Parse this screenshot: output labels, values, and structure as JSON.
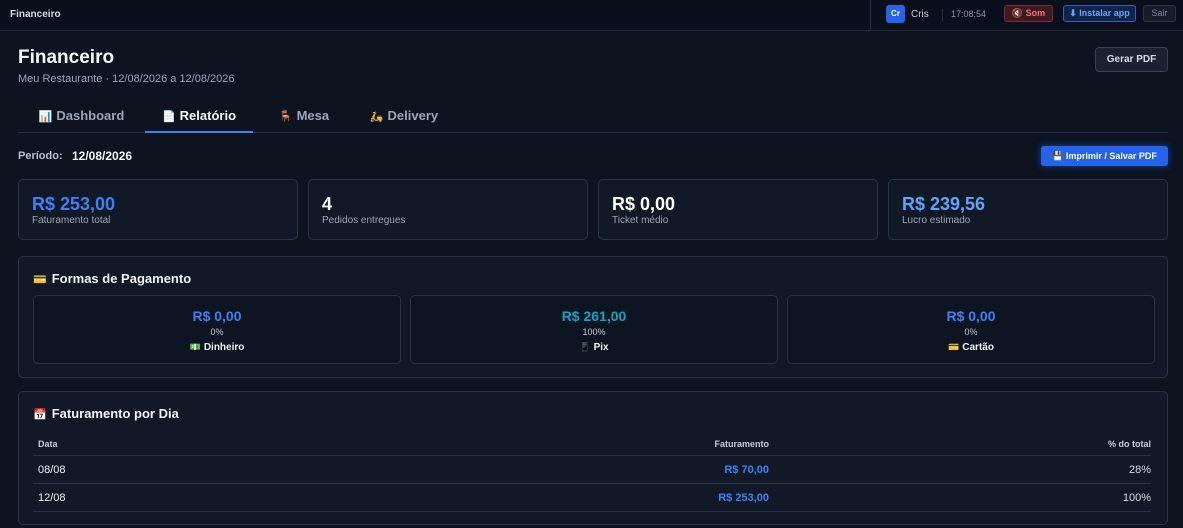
{
  "topbar": {
    "app_title": "Financeiro",
    "avatar_initials": "Cr",
    "username": "Cris",
    "clock": "17:08:54",
    "sound_label": "🔇 Som",
    "install_label": "⬇ Instalar app",
    "logout_label": "Sair"
  },
  "header": {
    "title": "Financeiro",
    "subtitle": "Meu Restaurante · 12/08/2026 a 12/08/2026",
    "pdf_button": "Gerar PDF"
  },
  "tabs": [
    {
      "icon": "📊",
      "label": "Dashboard",
      "active": false
    },
    {
      "icon": "📄",
      "label": "Relatório",
      "active": true
    },
    {
      "icon": "🪑",
      "label": "Mesa",
      "active": false
    },
    {
      "icon": "🛵",
      "label": "Delivery",
      "active": false
    }
  ],
  "period": {
    "label": "Período:",
    "value": "12/08/2026",
    "print_button": "💾 Imprimir / Salvar PDF"
  },
  "kpis": [
    {
      "value": "R$ 253,00",
      "label": "Faturamento total",
      "color": "#3b82f6"
    },
    {
      "value": "4",
      "label": "Pedidos entregues",
      "color": "#ffffff"
    },
    {
      "value": "R$ 0,00",
      "label": "Ticket médio",
      "color": "#ffffff"
    },
    {
      "value": "R$ 239,56",
      "label": "Lucro estimado",
      "color": "#60a5fa"
    }
  ],
  "payments": {
    "icon": "💳",
    "title": "Formas de Pagamento",
    "items": [
      {
        "amount": "R$ 0,00",
        "percent": "0%",
        "icon": "💵",
        "name": "Dinheiro",
        "color": "#3b82f6"
      },
      {
        "amount": "R$ 261,00",
        "percent": "100%",
        "icon": "📱",
        "name": "Pix",
        "color": "#0ea5c4"
      },
      {
        "amount": "R$ 0,00",
        "percent": "0%",
        "icon": "💳",
        "name": "Cartão",
        "color": "#3b82f6"
      }
    ]
  },
  "daily": {
    "icon": "📅",
    "title": "Faturamento por Dia",
    "columns": [
      "Data",
      "Faturamento",
      "% do total"
    ],
    "rows": [
      {
        "date": "08/08",
        "revenue": "R$ 70,00",
        "share": "28%"
      },
      {
        "date": "12/08",
        "revenue": "R$ 253,00",
        "share": "100%"
      }
    ]
  }
}
